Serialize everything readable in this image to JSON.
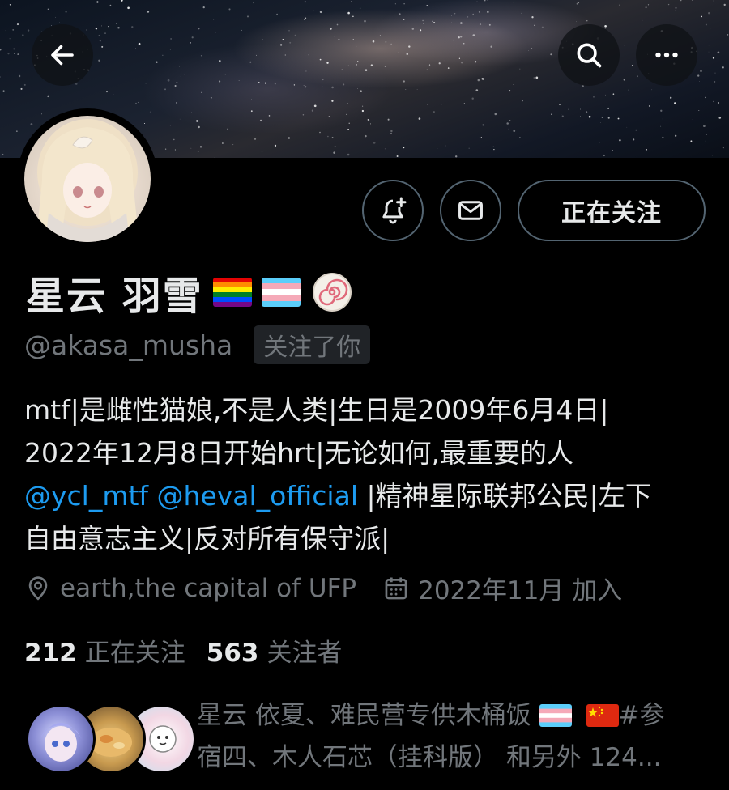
{
  "header": {
    "back_icon": "arrow-left-icon",
    "search_icon": "search-icon",
    "more_icon": "more-horizontal-icon"
  },
  "actions": {
    "notify_icon": "bell-plus-icon",
    "message_icon": "envelope-icon",
    "follow_label": "正在关注"
  },
  "profile": {
    "display_name": "星云 羽雪",
    "name_emojis": [
      "rainbow-flag",
      "transgender-flag",
      "fish-cake"
    ],
    "handle": "@akasa_musha",
    "follows_you_badge": "关注了你",
    "bio": {
      "line1": "mtf|是雌性猫娘,不是人类|生日是2009年6月4日|",
      "line2": "2022年12月8日开始hrt|无论如何,最重要的人",
      "mention1": "@ycl_mtf",
      "mention2": "@heval_official",
      "line3_rest": " |精神星际联邦公民|左下",
      "line4": "自由意志主义|反对所有保守派|"
    },
    "location": "earth,the capital of UFP",
    "joined": "2022年11月 加入"
  },
  "stats": {
    "following_count": "212",
    "following_label": "正在关注",
    "followers_count": "563",
    "followers_label": "关注者"
  },
  "followers_you_know": {
    "line1": "星云 依夏、难民营专供木桶饭",
    "line1_tail": "#参",
    "line2": "宿四、木人石芯（挂科版） 和另外 124..."
  },
  "colors": {
    "background": "#000000",
    "text_primary": "#e7e9ea",
    "text_secondary": "#71767b",
    "link": "#1d9bf0",
    "button_border": "#536471"
  }
}
